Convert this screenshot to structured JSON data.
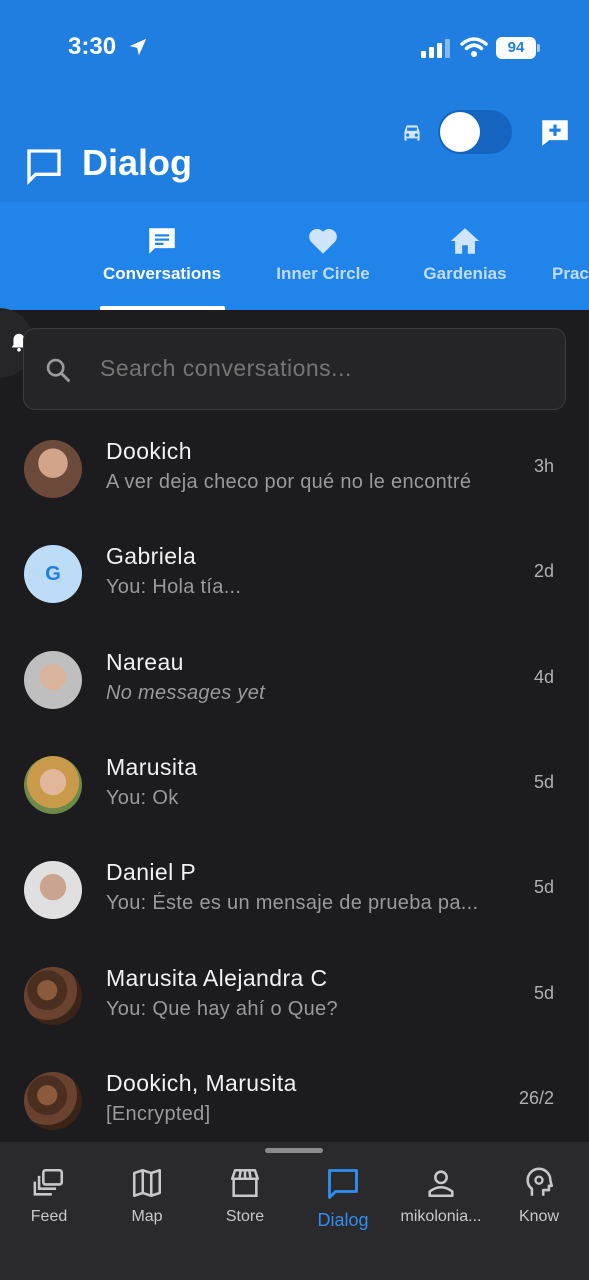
{
  "status_bar": {
    "time": "3:30",
    "battery": "94"
  },
  "header": {
    "title": "Dialog"
  },
  "tabs": [
    {
      "label": "Conversations",
      "icon": "chat-bubble-icon",
      "active": true
    },
    {
      "label": "Inner Circle",
      "icon": "heart-icon",
      "active": false
    },
    {
      "label": "Gardenias",
      "icon": "home-icon",
      "active": false
    },
    {
      "label": "Prac",
      "icon": "",
      "active": false
    }
  ],
  "search": {
    "placeholder": "Search conversations..."
  },
  "conversations": [
    {
      "name": "Dookich",
      "preview": "A ver deja checo por qué no le encontré",
      "time": "3h",
      "avatar": "photo"
    },
    {
      "name": "Gabriela",
      "preview": "You: Hola tía...",
      "time": "2d",
      "avatar_letter": "G"
    },
    {
      "name": "Nareau",
      "preview": "No messages yet",
      "time": "4d",
      "avatar": "photo"
    },
    {
      "name": "Marusita",
      "preview": "You: Ok",
      "time": "5d",
      "avatar": "photo"
    },
    {
      "name": "Daniel P",
      "preview": "You: Éste es un mensaje de prueba pa...",
      "time": "5d",
      "avatar": "photo"
    },
    {
      "name": "Marusita Alejandra C",
      "preview": "You: Que hay ahí o Que?",
      "time": "5d",
      "avatar": "photo"
    },
    {
      "name": "Dookich, Marusita",
      "preview": "[Encrypted]",
      "time": "26/2",
      "avatar": "photo"
    }
  ],
  "bottom_nav": [
    {
      "label": "Feed",
      "icon": "feed-icon"
    },
    {
      "label": "Map",
      "icon": "map-icon"
    },
    {
      "label": "Store",
      "icon": "store-icon"
    },
    {
      "label": "Dialog",
      "icon": "dialog-icon",
      "active": true
    },
    {
      "label": "mikolonia...",
      "icon": "person-icon"
    },
    {
      "label": "Know",
      "icon": "brain-icon"
    }
  ],
  "colors": {
    "primary": "#1f7ee0",
    "tab_bar": "#2184ea",
    "background": "#1c1c1e",
    "nav_active": "#2f8ff0"
  }
}
